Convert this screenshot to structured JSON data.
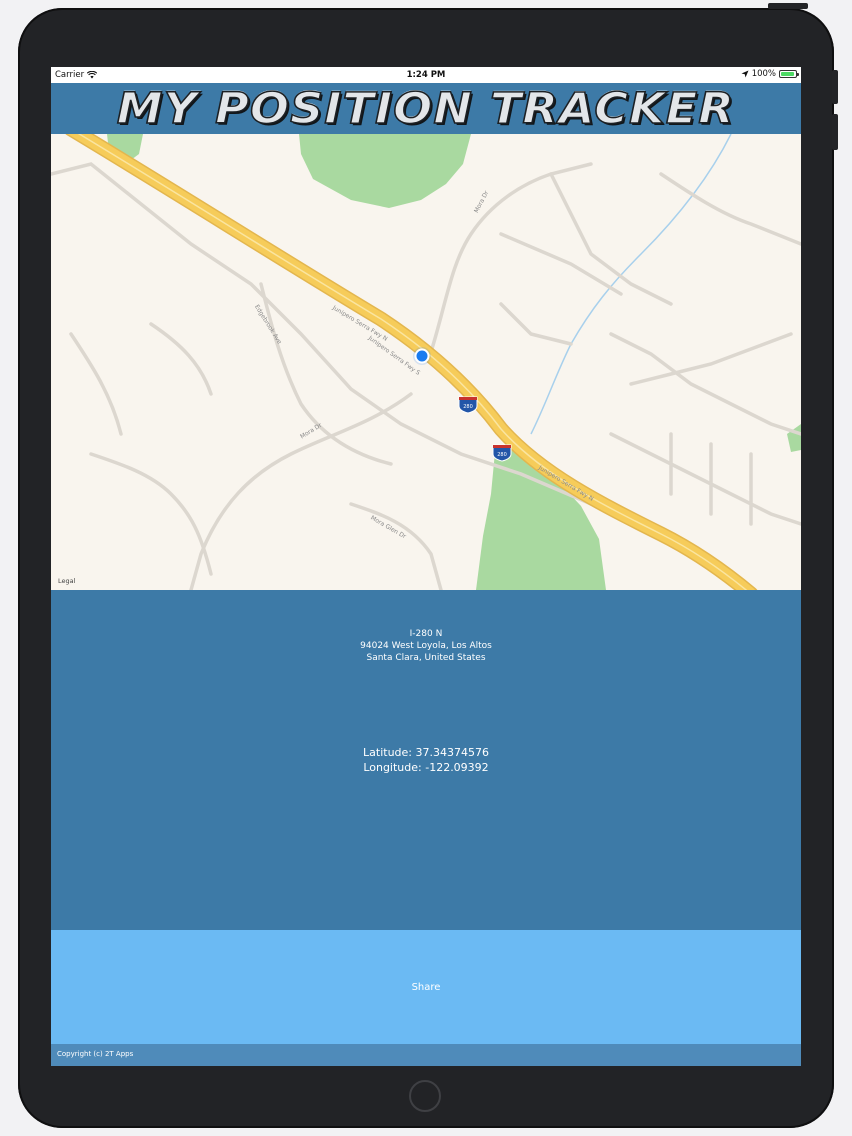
{
  "status_bar": {
    "carrier": "Carrier",
    "time": "1:24 PM",
    "battery": "100%"
  },
  "header": {
    "title": "MY POSITION TRACKER"
  },
  "map": {
    "labels": {
      "serra_fwy_n": "Junipero Serra Fwy N",
      "serra_fwy_s": "Junipero Serra Fwy S",
      "serra_fwy_n2": "Junipero Serra Fwy N",
      "mora_dr": "Mora Dr",
      "mora_dr2": "Mora Dr",
      "edgebrook_ave": "Edgebrook Ave",
      "mora_glen_dr": "Mora Glen Dr"
    },
    "shields": [
      "280",
      "280"
    ],
    "legal": "Legal"
  },
  "location": {
    "address_line1": "I-280 N",
    "address_line2": "94024 West Loyola, Los Altos",
    "address_line3": "Santa Clara, United States",
    "latitude": "Latitude: 37.34374576",
    "longitude": "Longitude: -122.09392"
  },
  "share": {
    "label": "Share"
  },
  "footer": {
    "copyright": "Copyright (c) 2T Apps"
  },
  "colors": {
    "panel": "#3d7aa7",
    "share": "#6bbaf3",
    "footer": "#4f8bba",
    "freeway": "#f6cc5a",
    "park": "#a9d9a0",
    "location_dot": "#1a7cf0"
  }
}
